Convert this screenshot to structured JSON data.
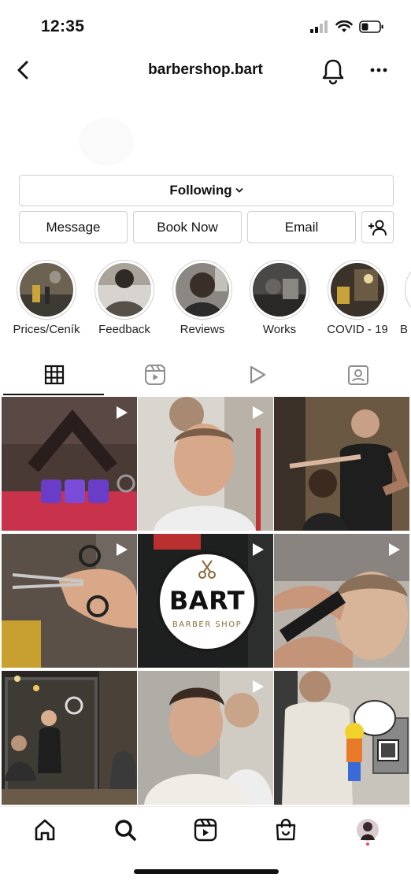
{
  "status": {
    "time": "12:35"
  },
  "header": {
    "username": "barbershop.bart"
  },
  "buttons": {
    "following": "Following",
    "message": "Message",
    "book_now": "Book Now",
    "email": "Email"
  },
  "highlights": [
    {
      "label": "Prices/Ceník"
    },
    {
      "label": "Feedback"
    },
    {
      "label": "Reviews"
    },
    {
      "label": "Works"
    },
    {
      "label": "COVID - 19"
    },
    {
      "label": "B"
    }
  ],
  "tabs": [
    "grid-icon",
    "reels-icon",
    "video-icon",
    "tagged-icon"
  ],
  "grid": {
    "logo_title": "BART",
    "logo_subtitle": "BARBER SHOP"
  },
  "bottom_nav": [
    "home-icon",
    "search-icon",
    "reels-icon",
    "shop-icon",
    "profile-avatar"
  ],
  "colors": {
    "notification_dot": "#ed4956",
    "border": "#cfcfcf"
  }
}
